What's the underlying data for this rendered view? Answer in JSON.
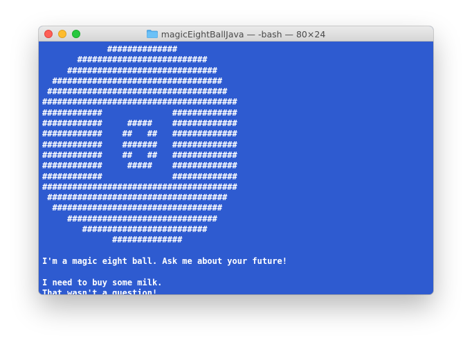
{
  "window": {
    "title": "magicEightBallJava — -bash — 80×24",
    "folder_icon": "folder-icon",
    "colors": {
      "terminal_bg": "#2e5bd0",
      "terminal_fg": "#ffffff"
    }
  },
  "terminal": {
    "ascii_art": [
      "             ##############",
      "       ##########################",
      "     ##############################",
      "  ##################################",
      " ####################################",
      "#######################################",
      "############              #############",
      "############     #####    #############",
      "############    ##   ##   #############",
      "############    #######   #############",
      "############    ##   ##   #############",
      "############     #####    #############",
      "############              #############",
      "#######################################",
      " ####################################",
      "  ##################################",
      "     ##############################",
      "        #########################",
      "              ##############"
    ],
    "output": [
      "",
      "I'm a magic eight ball. Ask me about your future!",
      "",
      "I need to buy some milk.",
      "That wasn't a question!"
    ]
  }
}
